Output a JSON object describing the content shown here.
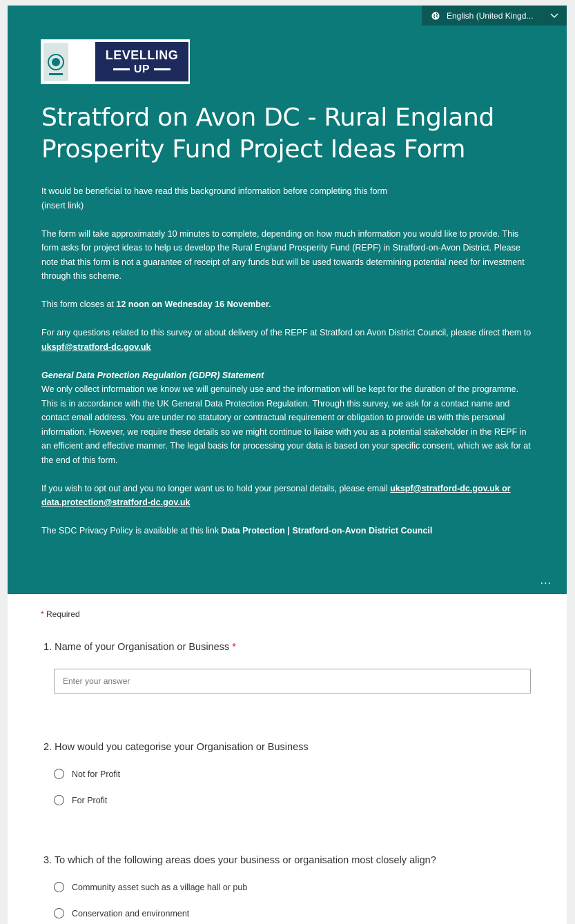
{
  "language": {
    "label": "English (United Kingd..."
  },
  "logo": {
    "line1": "LEVELLING",
    "line2": "UP"
  },
  "form": {
    "title": "Stratford on Avon DC - Rural England Prosperity Fund Project Ideas Form",
    "intro1": "It would be beneficial to have read this background information before completing this form",
    "intro1b": "(insert link)",
    "intro2": "The form will take approximately 10 minutes to complete, depending on how much information you would like to provide. This form asks for project ideas to help us develop the Rural England Prosperity Fund (REPF) in Stratford-on-Avon District. Please note that this form is not a guarantee of receipt of any funds but will be used towards determining potential need for investment through this scheme.",
    "closes_prefix": "This form closes at ",
    "closes_bold": "12 noon on Wednesday 16 November.",
    "questions_text": "For any questions related to this survey or about delivery of the REPF at Stratford on Avon District Council, please direct them to ",
    "questions_email": "ukspf@stratford-dc.gov.uk",
    "gdpr_heading": "General Data Protection Regulation (GDPR) Statement",
    "gdpr_body": "We only collect information we know we will genuinely use and the information will be kept for the duration of the programme. This is in accordance with the UK General Data Protection Regulation. Through this survey, we ask for a contact name and contact email address. You are under no statutory or contractual requirement or obligation to provide us with this personal information. However, we require these details so we might continue to liaise with you as a potential stakeholder in the REPF in an efficient and effective manner. The legal basis for processing your data is based on your specific consent, which we ask for at the end of this form.",
    "optout_text": "If you wish to opt out and you no longer want us to hold your personal details, please email ",
    "optout_email": "ukspf@stratford-dc.gov.uk or data.protection@stratford-dc.gov.uk",
    "privacy_text": "The SDC Privacy Policy is available at this link ",
    "privacy_link": "Data Protection | Stratford-on-Avon District Council",
    "more_label": "...",
    "required_star": "*",
    "required_label": " Required"
  },
  "questions": {
    "q1": {
      "label": "1. Name of your Organisation or Business",
      "star": " *",
      "placeholder": "Enter your answer"
    },
    "q2": {
      "label": "2. How would you categorise your Organisation or Business",
      "options": [
        "Not for Profit",
        "For Profit"
      ]
    },
    "q3": {
      "label": "3. To which of the following areas does your business or organisation most closely align?",
      "options": [
        "Community asset such as a village hall or pub",
        "Conservation and environment"
      ]
    }
  }
}
